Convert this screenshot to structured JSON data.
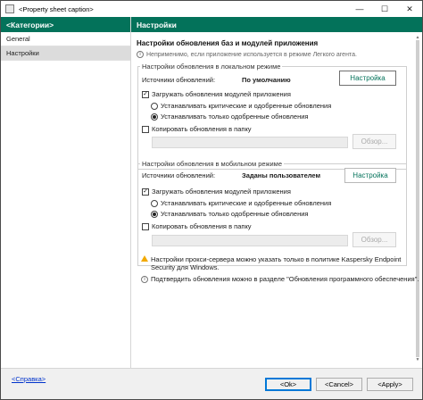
{
  "window": {
    "title": "<Property sheet caption>",
    "minimize": "—",
    "maximize": "☐",
    "close": "✕"
  },
  "sidebar": {
    "header": "<Категории>",
    "items": [
      {
        "label": "General"
      },
      {
        "label": "Настройки"
      }
    ]
  },
  "main": {
    "header": "Настройки",
    "section_title": "Настройки обновления баз и модулей приложения",
    "note": "Неприменимо, если приложение используется в режиме Легкого агента.",
    "local": {
      "group_label": "Настройки обновления в локальном режиме",
      "source_label": "Источники обновлений:",
      "source_value": "По умолчанию",
      "settings_button": "Настройка",
      "download_modules": "Загружать обновления модулей приложения",
      "radio_critical": "Устанавливать критические и одобренные обновления",
      "radio_approved": "Устанавливать только одобренные обновления",
      "copy_to_folder": "Копировать обновления в папку",
      "browse_button": "Обзор..."
    },
    "mobile": {
      "group_label": "Настройки обновления в мобильном режиме",
      "source_label": "Источники обновлений:",
      "source_value": "Заданы пользователем",
      "settings_button": "Настройка",
      "download_modules": "Загружать обновления модулей приложения",
      "radio_critical": "Устанавливать критические и одобренные обновления",
      "radio_approved": "Устанавливать только одобренные обновления",
      "copy_to_folder": "Копировать обновления в папку",
      "browse_button": "Обзор..."
    },
    "warning_line1": "Настройки прокси-сервера можно указать только в политике Kaspersky Endpoint",
    "warning_line2": "Security для Windows.",
    "info": "Подтвердить обновления можно в разделе \"Обновления программного обеспечения\"."
  },
  "footer": {
    "help_link": "<Справка>",
    "ok": "<Ok>",
    "cancel": "<Cancel>",
    "apply": "<Apply>"
  },
  "colors": {
    "accent": "#03725a",
    "link": "#0033cc",
    "warning": "#f2a900"
  }
}
